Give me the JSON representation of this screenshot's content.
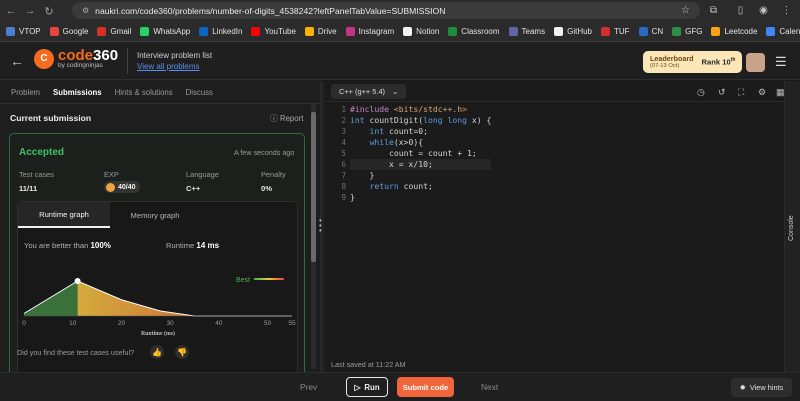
{
  "browser": {
    "url": "naukri.com/code360/problems/number-of-digits_4538242?leftPanelTabValue=SUBMISSION"
  },
  "bookmarks": [
    {
      "label": "VTOP",
      "color": "#4a7fd1"
    },
    {
      "label": "Google",
      "color": "#e8453c"
    },
    {
      "label": "Gmail",
      "color": "#d93025"
    },
    {
      "label": "WhatsApp",
      "color": "#25d366"
    },
    {
      "label": "LinkedIn",
      "color": "#0a66c2"
    },
    {
      "label": "YouTube",
      "color": "#ff0000"
    },
    {
      "label": "Drive",
      "color": "#f4b400"
    },
    {
      "label": "Instagram",
      "color": "#c13584"
    },
    {
      "label": "Notion",
      "color": "#f2f2f2"
    },
    {
      "label": "Classroom",
      "color": "#1e8e3e"
    },
    {
      "label": "Teams",
      "color": "#6264a7"
    },
    {
      "label": "GitHub",
      "color": "#f2f2f2"
    },
    {
      "label": "TUF",
      "color": "#d32f2f"
    },
    {
      "label": "CN",
      "color": "#2d68c4"
    },
    {
      "label": "GFG",
      "color": "#2f8d46"
    },
    {
      "label": "Leetcode",
      "color": "#ffa116"
    },
    {
      "label": "Calendar",
      "color": "#4285f4"
    }
  ],
  "header": {
    "logo_main": "code",
    "logo_number": "360",
    "logo_sub": "by codingninjas",
    "interview_label": "Interview problem list",
    "view_all": "View all problems",
    "leaderboard_title": "Leaderboard",
    "leaderboard_dates": "(07-13 Oct)",
    "rank_label": "Rank",
    "rank_value": "10",
    "rank_suffix": "th"
  },
  "left_tabs": [
    "Problem",
    "Submissions",
    "Hints & solutions",
    "Discuss"
  ],
  "submission": {
    "title": "Current submission",
    "report": "Report",
    "status": "Accepted",
    "time": "A few seconds ago",
    "labels": {
      "test_cases": "Test cases",
      "exp": "EXP",
      "language": "Language",
      "penalty": "Penalty"
    },
    "values": {
      "test_cases": "11/11",
      "exp": "40/40",
      "language": "C++",
      "penalty": "0%"
    },
    "graph_tabs": [
      "Runtime graph",
      "Memory graph"
    ],
    "better_label": "You are better than",
    "better_value": "100%",
    "runtime_label": "Runtime",
    "runtime_value": "14 ms",
    "best_label": "Best",
    "feedback": "Did you find these test cases useful?"
  },
  "chart_data": {
    "type": "area",
    "xlabel": "Runtime (ms)",
    "x_ticks": [
      0,
      10,
      20,
      30,
      40,
      50,
      55
    ],
    "xlim": [
      0,
      55
    ],
    "points": [
      [
        0,
        2
      ],
      [
        11,
        28
      ],
      [
        20,
        13
      ],
      [
        28,
        4
      ],
      [
        35,
        0
      ],
      [
        55,
        0
      ]
    ],
    "current_x": 11,
    "colors": {
      "green": "#3e7a3e",
      "highlight": "#f5a623",
      "red": "#e0443a"
    }
  },
  "editor": {
    "language": "C++ (g++ 5.4)",
    "lines": [
      "#include <bits/stdc++.h>",
      "int countDigit(long long x) {",
      "    int count=0;",
      "    while(x>0){",
      "        count = count + 1;",
      "        x = x/10;",
      "    }",
      "    return count;",
      "}"
    ],
    "saved": "Last saved at 11:22 AM"
  },
  "bottom": {
    "prev": "Prev",
    "run": "Run",
    "submit": "Submit code",
    "next": "Next",
    "hints": "View hints"
  },
  "console_label": "Console"
}
